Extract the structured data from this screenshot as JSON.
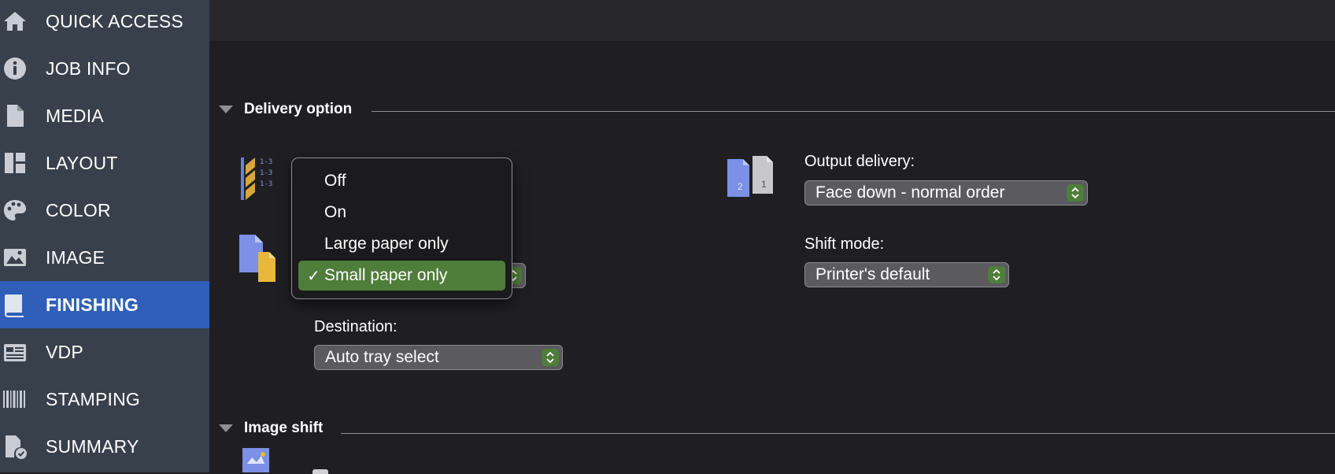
{
  "sidebar": {
    "items": [
      {
        "label": "QUICK ACCESS",
        "icon": "home-icon"
      },
      {
        "label": "JOB INFO",
        "icon": "info-icon"
      },
      {
        "label": "MEDIA",
        "icon": "document-icon"
      },
      {
        "label": "LAYOUT",
        "icon": "layout-icon"
      },
      {
        "label": "COLOR",
        "icon": "palette-icon"
      },
      {
        "label": "IMAGE",
        "icon": "image-icon"
      },
      {
        "label": "FINISHING",
        "icon": "book-icon",
        "active": true
      },
      {
        "label": "VDP",
        "icon": "vdp-icon"
      },
      {
        "label": "STAMPING",
        "icon": "barcode-icon"
      },
      {
        "label": "SUMMARY",
        "icon": "summary-icon"
      }
    ]
  },
  "sections": {
    "delivery": {
      "title": "Delivery option"
    },
    "image_shift": {
      "title": "Image shift"
    }
  },
  "fields": {
    "destination": {
      "label": "Destination:",
      "value": "Auto tray select"
    },
    "output_delivery": {
      "label": "Output delivery:",
      "value": "Face down - normal order"
    },
    "shift_mode": {
      "label": "Shift mode:",
      "value": "Printer's default"
    }
  },
  "menu": {
    "items": [
      {
        "label": "Off",
        "selected": false
      },
      {
        "label": "On",
        "selected": false
      },
      {
        "label": "Large paper only",
        "selected": false
      },
      {
        "label": "Small paper only",
        "selected": true
      }
    ],
    "checkmark": "✓"
  },
  "colors": {
    "sidebar_bg": "#38404c",
    "active_bg": "#2f5fb8",
    "accent_green": "#4f7d3a",
    "content_bg": "#1f1f23"
  }
}
